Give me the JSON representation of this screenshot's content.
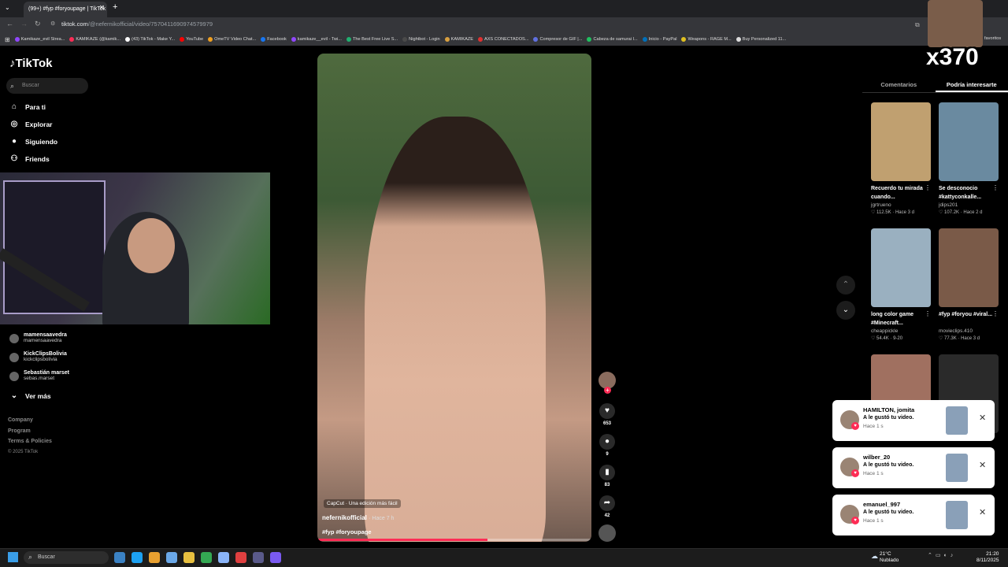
{
  "browser": {
    "tab_title": "(99+) #fyp #foryoupage | TikTok",
    "url_host": "tiktok.com",
    "url_path": "/@nefernikofficial/video/7570411690974579979",
    "bookmarks": [
      {
        "label": "Kamikaze_evil Strea...",
        "color": "#9147ff"
      },
      {
        "label": "KAMIKAZE (@kamik...",
        "color": "#fe2c55"
      },
      {
        "label": "(43) TikTok - Make Y...",
        "color": "#ffffff"
      },
      {
        "label": "YouTube",
        "color": "#ff0000"
      },
      {
        "label": "OmeTV Video Chat...",
        "color": "#f0a020"
      },
      {
        "label": "Facebook",
        "color": "#1877f2"
      },
      {
        "label": "kamikaze__evil - Twi...",
        "color": "#9147ff"
      },
      {
        "label": "The Best Free Live S...",
        "color": "#20b070"
      },
      {
        "label": "Nightbot - Login",
        "color": "#4a4a4a"
      },
      {
        "label": "KAMIKAZE",
        "color": "#d8a040"
      },
      {
        "label": "AXS CONECTADOS...",
        "color": "#e03030"
      },
      {
        "label": "Compresor de GIF |...",
        "color": "#6070e0"
      },
      {
        "label": "Cabeza de samurai I...",
        "color": "#20c060"
      },
      {
        "label": "Inicio - PayPal",
        "color": "#0070ba"
      },
      {
        "label": "Weapons - RAGE M...",
        "color": "#e0c020"
      },
      {
        "label": "Buy Personalized 11...",
        "color": "#dddddd"
      }
    ],
    "favorites_label": "favoritos"
  },
  "sidebar": {
    "logo": "TikTok",
    "search_placeholder": "Buscar",
    "nav": [
      {
        "label": "Para ti",
        "icon": "home-icon",
        "glyph": "⌂"
      },
      {
        "label": "Explorar",
        "icon": "compass-icon",
        "glyph": "◎"
      },
      {
        "label": "Siguiendo",
        "icon": "following-icon",
        "glyph": "●"
      },
      {
        "label": "Friends",
        "icon": "friends-icon",
        "glyph": "⚇"
      }
    ],
    "accounts": [
      {
        "name": "mamensaavedra",
        "handle": "mamensaavedra"
      },
      {
        "name": "KickClipsBolivia",
        "handle": "kickclipsbolivia"
      },
      {
        "name": "Sebastián marset",
        "handle": "sebas.marset"
      }
    ],
    "see_more": "Ver más",
    "footer": [
      "Company",
      "Program",
      "Terms & Policies",
      "© 2025 TikTok"
    ]
  },
  "video": {
    "capcut_label": "CapCut · Una edición más fácil",
    "author": "nefernikofficial",
    "time_ago": "· Hace 7 h",
    "hashtags": "#fyp #foryoupage",
    "progress": 0.62,
    "likes": "653",
    "comments": "9",
    "saves": "83",
    "shares": "42"
  },
  "panel": {
    "tab_comments": "Comentarios",
    "tab_recommended": "Podría interesarte",
    "cards": [
      {
        "title": "Recuerdo tu mirada cuando...",
        "user": "jgrtrueno",
        "likes": "112.5K",
        "ago": "Hace 3 d",
        "color": "#c0a070"
      },
      {
        "title": "Se desconocio #kattyconkalle...",
        "user": "jdips201",
        "likes": "107.2K",
        "ago": "Hace 2 d",
        "color": "#6a8aa0"
      },
      {
        "title": "long color game #Minecraft...",
        "user": "cheappickle",
        "likes": "54.4K",
        "ago": "9-20",
        "color": "#9ab0c0"
      },
      {
        "title": "#fyp #foryou #viral...",
        "user": "movieclips.410",
        "likes": "77.3K",
        "ago": "Hace 3 d",
        "color": "#7a5a48"
      },
      {
        "title": "",
        "user": "",
        "likes": "",
        "ago": "",
        "color": "#a07060"
      },
      {
        "title": "",
        "user": "",
        "likes": "",
        "ago": "",
        "color": "#2a2a2a"
      }
    ]
  },
  "notifications": [
    {
      "user": "HAMILTON, jomita",
      "message": "A le gustó tu video.",
      "time": "Hace 1 s"
    },
    {
      "user": "wilber_20",
      "message": "A le gustó tu video.",
      "time": "Hace 1 s"
    },
    {
      "user": "emanuel_997",
      "message": "A le gustó tu video.",
      "time": "Hace 1 s"
    }
  ],
  "overlay": {
    "multiplier": "x370"
  },
  "taskbar": {
    "search_placeholder": "Buscar",
    "temperature": "21°C",
    "weather": "Nublado",
    "time": "21:20",
    "date": "8/11/2025"
  }
}
